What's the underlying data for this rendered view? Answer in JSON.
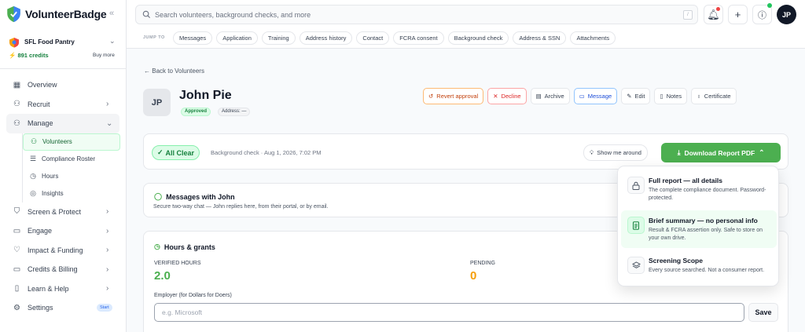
{
  "brand": {
    "name": "VolunteerBadge"
  },
  "org": {
    "name": "SFL Food Pantry",
    "credits": "891 credits",
    "buy_more": "Buy more"
  },
  "sidebar": {
    "items": [
      {
        "label": "Overview",
        "icon": "grid-icon"
      },
      {
        "label": "Recruit",
        "icon": "user-plus-icon"
      },
      {
        "label": "Manage",
        "icon": "users-icon"
      },
      {
        "label": "Screen & Protect",
        "icon": "shield-icon"
      },
      {
        "label": "Engage",
        "icon": "chat-icon"
      },
      {
        "label": "Impact & Funding",
        "icon": "heart-icon"
      },
      {
        "label": "Credits & Billing",
        "icon": "card-icon"
      },
      {
        "label": "Learn & Help",
        "icon": "book-icon"
      },
      {
        "label": "Settings",
        "icon": "gear-icon",
        "badge": "Start"
      }
    ],
    "manage_sub": [
      {
        "label": "Volunteers",
        "icon": "users-icon",
        "active": true
      },
      {
        "label": "Compliance Roster",
        "icon": "list-icon"
      },
      {
        "label": "Hours",
        "icon": "clock-icon"
      },
      {
        "label": "Insights",
        "icon": "compass-icon"
      }
    ]
  },
  "search": {
    "placeholder": "Search volunteers, background checks, and more",
    "shortcut": "/"
  },
  "user": {
    "initials": "JP"
  },
  "jump": {
    "label": "JUMP TO",
    "items": [
      "Messages",
      "Application",
      "Training",
      "Address history",
      "Contact",
      "FCRA consent",
      "Background check",
      "Address & SSN",
      "Attachments"
    ]
  },
  "volunteer": {
    "back": "Back to Volunteers",
    "initials": "JP",
    "name": "John Pie",
    "status": "Approved",
    "address": "Address: —"
  },
  "actions": {
    "revert": "Revert approval",
    "decline": "Decline",
    "archive": "Archive",
    "message": "Message",
    "edit": "Edit",
    "notes": "Notes",
    "certificate": "Certificate"
  },
  "check": {
    "status": "All Clear",
    "text": "Background check · Aug 1, 2026, 7:02 PM",
    "show_around": "Show me around",
    "download": "Download Report PDF"
  },
  "messages": {
    "title": "Messages with John",
    "sub": "Secure two-way chat — John replies here, from their portal, or by email."
  },
  "hours": {
    "title": "Hours & grants",
    "verified_label": "VERIFIED HOURS",
    "verified_value": "2.0",
    "pending_label": "PENDING",
    "pending_value": "0",
    "employer_label": "Employer (for Dollars for Doers)",
    "employer_placeholder": "e.g. Microsoft",
    "save": "Save"
  },
  "dropdown": {
    "items": [
      {
        "title": "Full report — all details",
        "desc": "The complete compliance document. Password-protected."
      },
      {
        "title": "Brief summary — no personal info",
        "desc": "Result & FCRA assertion only. Safe to store on your own drive."
      },
      {
        "title": "Screening Scope",
        "desc": "Every source searched. Not a consumer report."
      }
    ]
  },
  "colors": {
    "accent": "#4caf50",
    "pending": "#f59e0b",
    "approved_bg": "#dcfce7"
  }
}
